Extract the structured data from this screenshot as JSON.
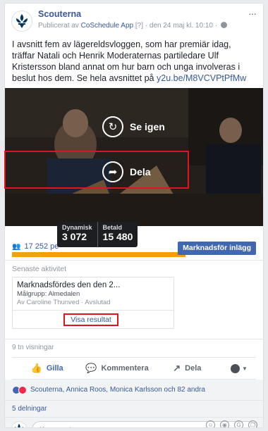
{
  "post": {
    "page_name": "Scouterna",
    "meta_prefix": "Publicerat av ",
    "meta_app": "CoSchedule App",
    "meta_suffix": " [?] · den 24 maj kl. 10:10 · ",
    "more": "···",
    "text": "I avsnitt fem av lägereldsvloggen, som har premiär idag, träffar Natali och Henrik Moderaternas partiledare Ulf Kristersson bland annat om hur barn och unga involveras i beslut hos dem. Se hela avsnittet på ",
    "link": "y2u.be/M8VCVPtPfMw"
  },
  "video": {
    "replay_label": "Se igen",
    "share_label": "Dela"
  },
  "boost": {
    "tooltip": {
      "organic_label": "Dynamisk",
      "organic_value": "3 072",
      "paid_label": "Betald",
      "paid_value": "15 480"
    },
    "reach_text": "17 252 pe",
    "button_label": "Marknadsför inlägg",
    "organic_fraction": 0.166,
    "paid_fraction": 0.834
  },
  "recent": {
    "title": "Senaste aktivitet",
    "activity_title": "Marknadsfördes den den 2...",
    "target": "Målgrupp: Almedalen",
    "by": "Av Caroline Thunved · Avslutad",
    "view_results": "Visa resultat"
  },
  "stats": {
    "views": "9 tn visningar"
  },
  "actions": {
    "like": "Gilla",
    "comment": "Kommentera",
    "share": "Dela"
  },
  "reactions": {
    "text": "Scouterna, Annica Roos, Monica Karlsson och 82 andra"
  },
  "shares": {
    "text": "5 delningar"
  },
  "comment": {
    "placeholder": "Kommentera..."
  },
  "colors": {
    "brand_blue": "#4267b2",
    "link_blue": "#385898",
    "highlight_red": "#e0141e",
    "bar_orange": "#f59e00"
  },
  "icons": [
    "globe-icon",
    "replay-icon",
    "share-arrow-icon",
    "people-icon",
    "like-thumb-icon",
    "comment-bubble-icon",
    "share-icon",
    "emoji-icon",
    "camera-icon",
    "gif-icon",
    "sticker-icon"
  ]
}
